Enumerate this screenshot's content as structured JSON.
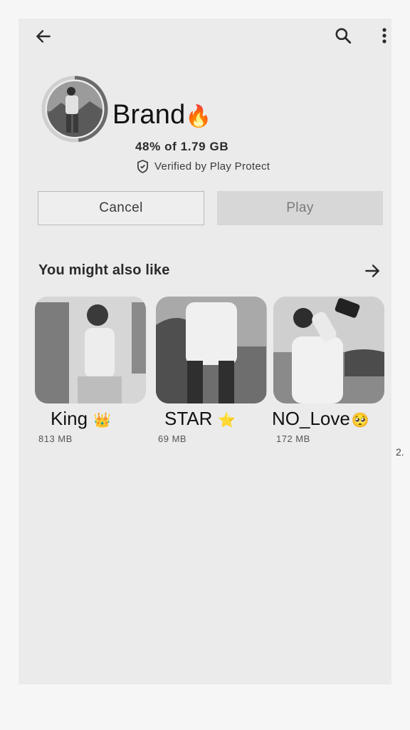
{
  "app": {
    "title": "Brand",
    "title_emoji": "🔥",
    "progress": "48% of 1.79 GB",
    "progress_fraction": 0.48,
    "verified": "Verified by Play Protect"
  },
  "actions": {
    "cancel_label": "Cancel",
    "play_label": "Play"
  },
  "section": {
    "title": "You might also like"
  },
  "cards": [
    {
      "name": "King",
      "emoji": "👑",
      "size": "813 MB"
    },
    {
      "name": "STAR",
      "emoji": "⭐",
      "size": "69 MB"
    },
    {
      "name": "NO_Love",
      "emoji": "🥺",
      "size": "172 MB"
    }
  ],
  "peek_card": {
    "label": "2."
  },
  "icons": {
    "back": "arrow-back-icon",
    "search": "search-icon",
    "more": "more-vert-icon",
    "shield": "shield-icon",
    "forward": "arrow-forward-icon"
  }
}
